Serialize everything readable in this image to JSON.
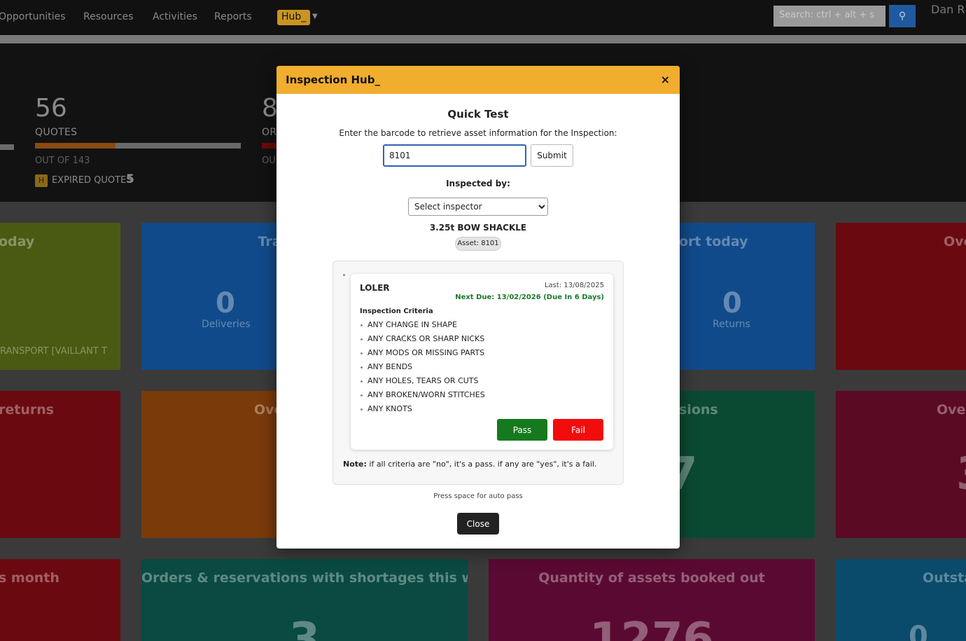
{
  "nav": {
    "items": [
      "Opportunities",
      "Resources",
      "Activities",
      "Reports"
    ],
    "hub_label": "Hub_",
    "search_placeholder": "Search: ctrl + alt + s",
    "user_name": "Dan Ri"
  },
  "stats": {
    "quotes": {
      "value": "56",
      "label": "QUOTES",
      "sub": "OUT OF 143",
      "progress_fraction": 0.39
    },
    "orders": {
      "value": "8",
      "label": "OR",
      "sub": "OU"
    },
    "expired": {
      "badge": "H",
      "label": "EXPIRED QUOTES",
      "count": "5"
    }
  },
  "tiles": [
    {
      "title": "oday",
      "value": "",
      "sub": "RANSPORT [VAILLANT T",
      "color": "#4a5a12"
    },
    {
      "title": "Tra",
      "value": "0",
      "sub": "Deliveries",
      "color": "#114a8a"
    },
    {
      "title": "ort today",
      "value": "0",
      "sub": "Returns",
      "color": "#114a8a"
    },
    {
      "title": "Ove",
      "value": "",
      "sub": "",
      "color": "#6a0a10"
    },
    {
      "title": "returns",
      "value": "",
      "sub": "",
      "color": "#6a0a10"
    },
    {
      "title": "Ove",
      "value": "",
      "sub": "",
      "color": "#7a3a0a"
    },
    {
      "title": "sions",
      "value": "7",
      "sub": "",
      "color": "#0a4a32"
    },
    {
      "title": "Over",
      "value": "3",
      "sub": "",
      "color": "#5a0a22"
    },
    {
      "title": "s month",
      "value": "",
      "sub": "",
      "color": "#6a0a10"
    },
    {
      "title": "Orders & reservations with shortages this week",
      "value": "3",
      "sub": "",
      "color": "#0a4a42"
    },
    {
      "title": "Quantity of assets booked out",
      "value": "1276",
      "sub": "",
      "color": "#5a0a32"
    },
    {
      "title": "Outsta",
      "value": "0",
      "sub": "",
      "color": "#0a4a6a"
    }
  ],
  "modal": {
    "title": "Inspection Hub_",
    "close_symbol": "×",
    "heading": "Quick Test",
    "instruction": "Enter the barcode to retrieve asset information for the Inspection:",
    "barcode_value": "8101",
    "submit_label": "Submit",
    "inspected_by_label": "Inspected by:",
    "inspector_selected": "Select inspector",
    "asset_name": "3.25t BOW SHACKLE",
    "asset_badge": "Asset: 8101",
    "inspection": {
      "type": "LOLER",
      "last": "Last: 13/08/2025",
      "next_due": "Next Due: 13/02/2026 (Due In 6 Days)",
      "criteria_title": "Inspection Criteria",
      "criteria": [
        "ANY CHANGE IN SHAPE",
        "ANY CRACKS OR SHARP NICKS",
        "ANY MODS OR MISSING PARTS",
        "ANY BENDS",
        "ANY HOLES, TEARS OR CUTS",
        "ANY BROKEN/WORN STITCHES",
        "ANY KNOTS"
      ],
      "pass_label": "Pass",
      "fail_label": "Fail"
    },
    "note_label": "Note:",
    "note_text": " if all criteria are \"no\", it's a pass. if any are \"yes\", it's a fail.",
    "hint": "Press space for auto pass",
    "close_label": "Close"
  },
  "colors": {
    "header_accent": "#f0ad2e",
    "pass": "#157a1d",
    "fail": "#f20d0d",
    "due_ok": "#1b7a2a",
    "input_focus": "#2f63b5"
  }
}
